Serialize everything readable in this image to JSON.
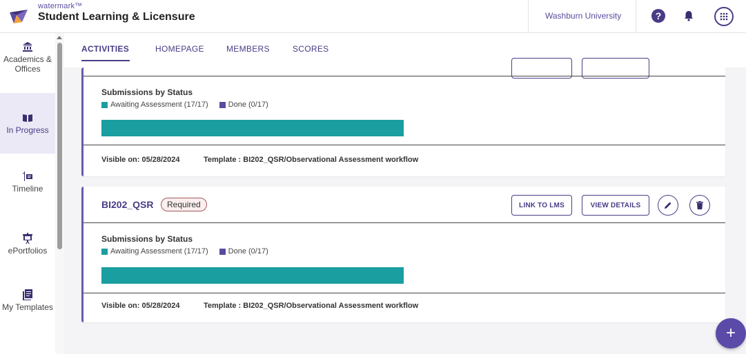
{
  "header": {
    "brand_small": "watermark™",
    "app_title": "Student Learning & Licensure",
    "institution": "Washburn University",
    "help_symbol": "?"
  },
  "sidebar": {
    "items": [
      {
        "label": "Academics & Offices",
        "icon": "institution-icon",
        "active": false
      },
      {
        "label": "In Progress",
        "icon": "open-book-icon",
        "active": true
      },
      {
        "label": "Timeline",
        "icon": "timeline-icon",
        "active": false
      },
      {
        "label": "ePortfolios",
        "icon": "presentation-icon",
        "active": false
      },
      {
        "label": "My Templates",
        "icon": "templates-icon",
        "active": false
      }
    ]
  },
  "tabs": [
    {
      "label": "ACTIVITIES",
      "active": true
    },
    {
      "label": "HOMEPAGE",
      "active": false
    },
    {
      "label": "MEMBERS",
      "active": false
    },
    {
      "label": "SCORES",
      "active": false
    }
  ],
  "cards": [
    {
      "title": "",
      "section_label": "Submissions by Status",
      "legend_awaiting": "Awaiting Assessment (17/17)",
      "legend_done": "Done (0/17)",
      "awaiting_fraction": 1.0,
      "visible_on": "Visible on: 05/28/2024",
      "template": "Template : BI202_QSR/Observational Assessment workflow"
    },
    {
      "title": "BI202_QSR",
      "badge": "Required",
      "link_lms": "LINK TO LMS",
      "view_details": "VIEW DETAILS",
      "section_label": "Submissions by Status",
      "legend_awaiting": "Awaiting Assessment (17/17)",
      "legend_done": "Done (0/17)",
      "awaiting_fraction": 1.0,
      "visible_on": "Visible on: 05/28/2024",
      "template": "Template : BI202_QSR/Observational Assessment workflow"
    }
  ],
  "fab": {
    "symbol": "+"
  },
  "colors": {
    "primary": "#4a3b86",
    "awaiting": "#1a9ea0",
    "done": "#5b4a9e",
    "annotation": "#e0201c"
  }
}
